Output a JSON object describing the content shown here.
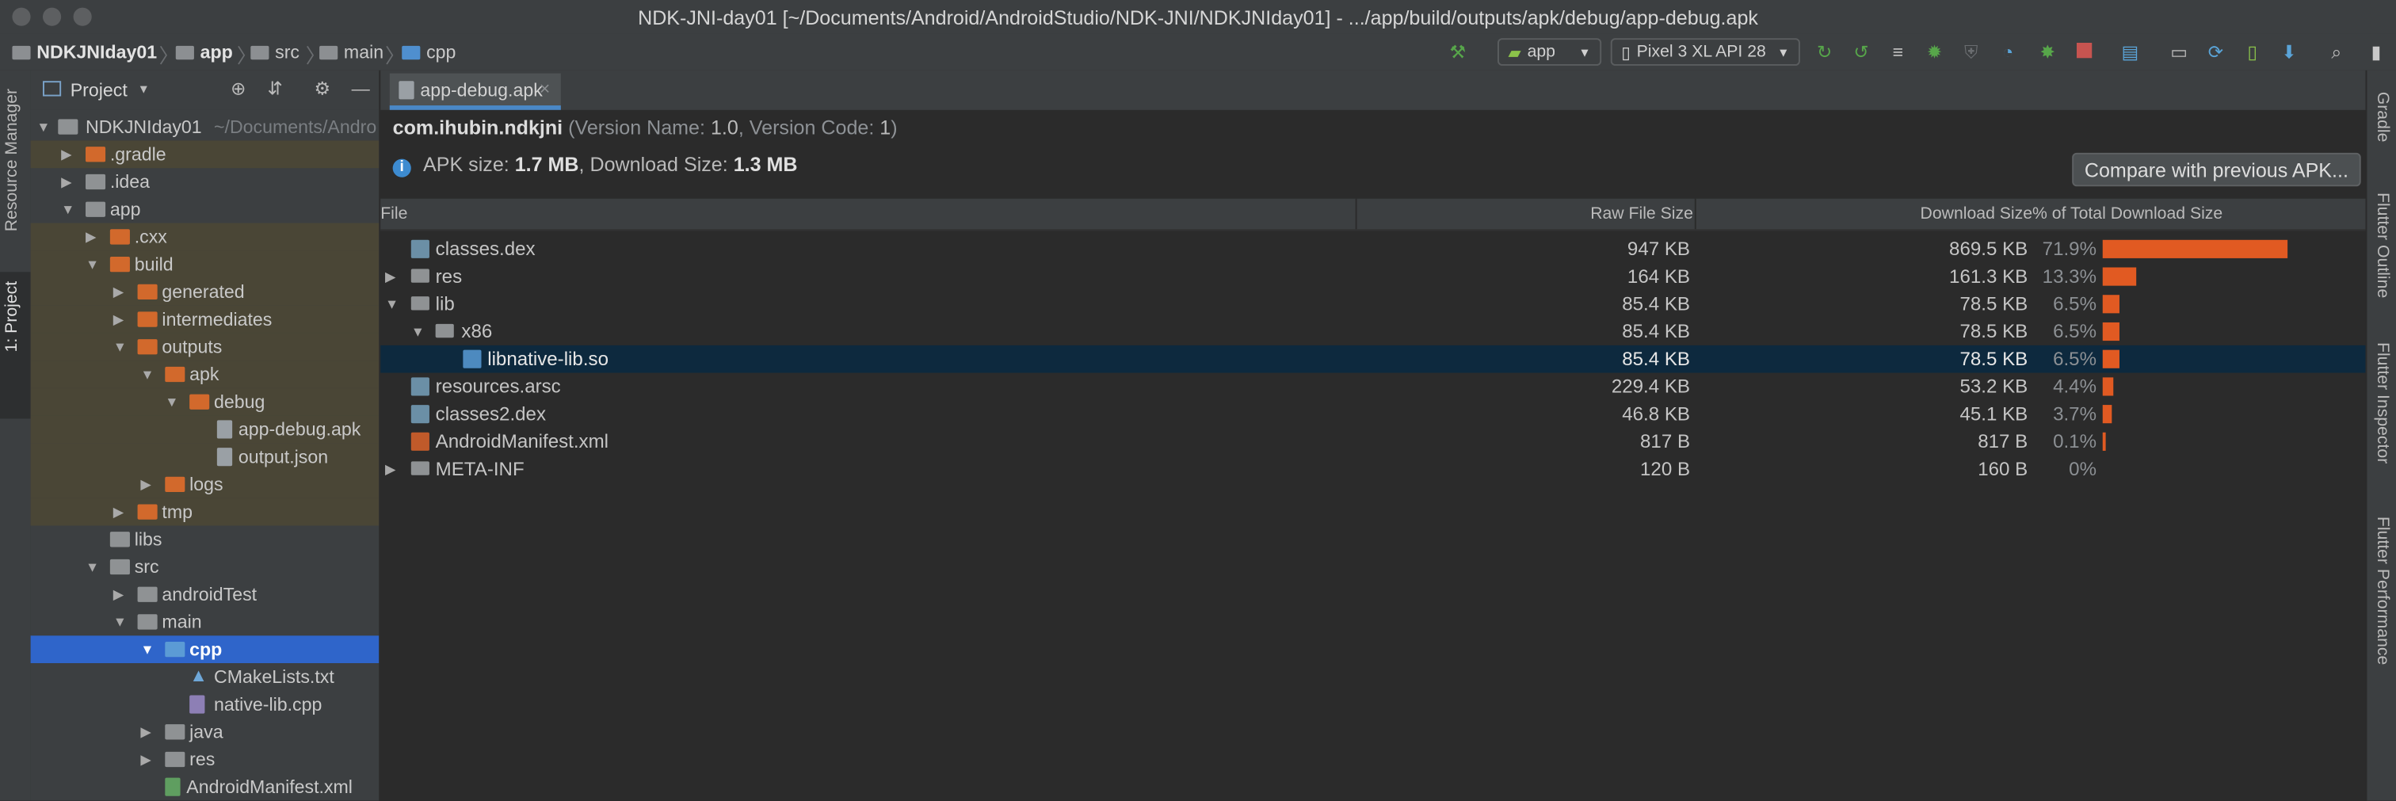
{
  "window": {
    "title": "NDK-JNI-day01 [~/Documents/Android/AndroidStudio/NDK-JNI/NDKJNIday01] - .../app/build/outputs/apk/debug/app-debug.apk"
  },
  "breadcrumb": [
    "NDKJNIday01",
    "app",
    "src",
    "main",
    "cpp"
  ],
  "toolbar": {
    "run_config": "app",
    "device": "Pixel 3 XL API 28"
  },
  "left_strip": {
    "resource_manager": "Resource Manager",
    "project": "1: Project"
  },
  "right_strip": [
    "Gradle",
    "Flutter Outline",
    "Flutter Inspector",
    "Flutter Performance"
  ],
  "project_panel": {
    "header": "Project",
    "root_label": "NDKJNIday01",
    "root_path": "~/Documents/Andro",
    "items": [
      {
        "label": ".gradle"
      },
      {
        "label": ".idea"
      },
      {
        "label": "app"
      },
      {
        "label": ".cxx"
      },
      {
        "label": "build"
      },
      {
        "label": "generated"
      },
      {
        "label": "intermediates"
      },
      {
        "label": "outputs"
      },
      {
        "label": "apk"
      },
      {
        "label": "debug"
      },
      {
        "label": "app-debug.apk"
      },
      {
        "label": "output.json"
      },
      {
        "label": "logs"
      },
      {
        "label": "tmp"
      },
      {
        "label": "libs"
      },
      {
        "label": "src"
      },
      {
        "label": "androidTest"
      },
      {
        "label": "main"
      },
      {
        "label": "cpp"
      },
      {
        "label": "CMakeLists.txt"
      },
      {
        "label": "native-lib.cpp"
      },
      {
        "label": "java"
      },
      {
        "label": "res"
      },
      {
        "label": "AndroidManifest.xml"
      }
    ]
  },
  "editor_tab": {
    "label": "app-debug.apk"
  },
  "apk": {
    "package": "com.ihubin.ndkjni",
    "version_name_label": "Version Name:",
    "version_name": "1.0",
    "version_code_label": "Version Code:",
    "version_code": "1",
    "size_label": "APK size:",
    "size": "1.7 MB",
    "download_label": "Download Size:",
    "download_size": "1.3 MB",
    "compare_button": "Compare with previous APK..."
  },
  "table": {
    "headers": {
      "file": "File",
      "raw": "Raw File Size",
      "download": "Download Size",
      "percent": "% of Total Download Size"
    },
    "rows": [
      {
        "name": "classes.dex",
        "raw": "947 KB",
        "download": "869.5 KB",
        "percent": "71.9%",
        "fraction": 0.719
      },
      {
        "name": "res",
        "raw": "164 KB",
        "download": "161.3 KB",
        "percent": "13.3%",
        "fraction": 0.133
      },
      {
        "name": "lib",
        "raw": "85.4 KB",
        "download": "78.5 KB",
        "percent": "6.5%",
        "fraction": 0.065
      },
      {
        "name": "x86",
        "raw": "85.4 KB",
        "download": "78.5 KB",
        "percent": "6.5%",
        "fraction": 0.065
      },
      {
        "name": "libnative-lib.so",
        "raw": "85.4 KB",
        "download": "78.5 KB",
        "percent": "6.5%",
        "fraction": 0.065
      },
      {
        "name": "resources.arsc",
        "raw": "229.4 KB",
        "download": "53.2 KB",
        "percent": "4.4%",
        "fraction": 0.044
      },
      {
        "name": "classes2.dex",
        "raw": "46.8 KB",
        "download": "45.1 KB",
        "percent": "3.7%",
        "fraction": 0.037
      },
      {
        "name": "AndroidManifest.xml",
        "raw": "817 B",
        "download": "817 B",
        "percent": "0.1%",
        "fraction": 0.001
      },
      {
        "name": "META-INF",
        "raw": "120 B",
        "download": "160 B",
        "percent": "0%",
        "fraction": 0
      }
    ]
  },
  "colors": {
    "accent": "#2f65ca",
    "bar": "#e15a22",
    "selected_row": "#0d293e"
  }
}
